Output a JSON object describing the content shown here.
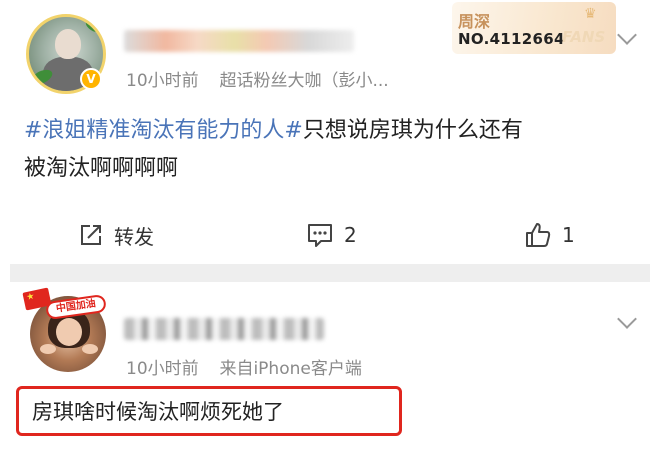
{
  "post1": {
    "fans_card": {
      "name": "周深",
      "number": "NO.4112664",
      "fans_label": "FANS"
    },
    "verified_badge": "V",
    "time": "10小时前",
    "source": "超话粉丝大咖（彭小...",
    "hashtag": "#浪姐精准淘汰有能力的人#",
    "text_line1": "只想说房琪为什么还有",
    "text_line2": "被淘汰啊啊啊啊",
    "actions": {
      "repost_label": "转发",
      "comment_count": "2",
      "like_count": "1"
    }
  },
  "post2": {
    "avatar_banner": "中国加油",
    "time": "10小时前",
    "source": "来自iPhone客户端",
    "reply_text": "房琪啥时候淘汰啊烦死她了"
  },
  "colors": {
    "hashtag": "#4a74b8",
    "meta": "#8a8a8a",
    "highlight": "#e0261e",
    "verified": "#ffb400"
  }
}
